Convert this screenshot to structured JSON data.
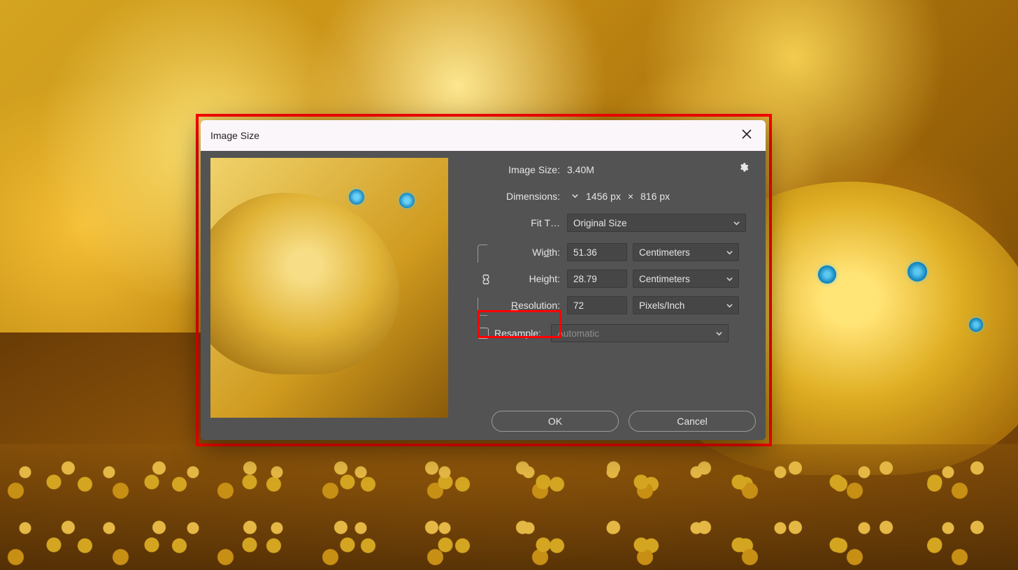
{
  "dialog": {
    "title": "Image Size",
    "image_size_label": "Image Size:",
    "image_size_value": "3.40M",
    "dimensions_label": "Dimensions:",
    "dimensions_w": "1456 px",
    "dimensions_sep": "×",
    "dimensions_h": "816 px",
    "fit_to_label": "Fit T…",
    "fit_to_value": "Original Size",
    "width_label": "Width:",
    "width_value": "51.36",
    "width_unit": "Centimeters",
    "height_label": "Height:",
    "height_value": "28.79",
    "height_unit": "Centimeters",
    "resolution_label": "Resolution:",
    "resolution_value": "72",
    "resolution_unit": "Pixels/Inch",
    "resample_label_pre": "Re",
    "resample_label_u": "s",
    "resample_label_post": "ample:",
    "resample_value": "Automatic",
    "width_u": "d",
    "width_pre": "Wi",
    "width_post": "th:",
    "height_u": "g",
    "height_pre": "Hei",
    "height_post": "ht:",
    "res_u": "R",
    "res_post": "esolution:",
    "ok": "OK",
    "cancel": "Cancel"
  }
}
